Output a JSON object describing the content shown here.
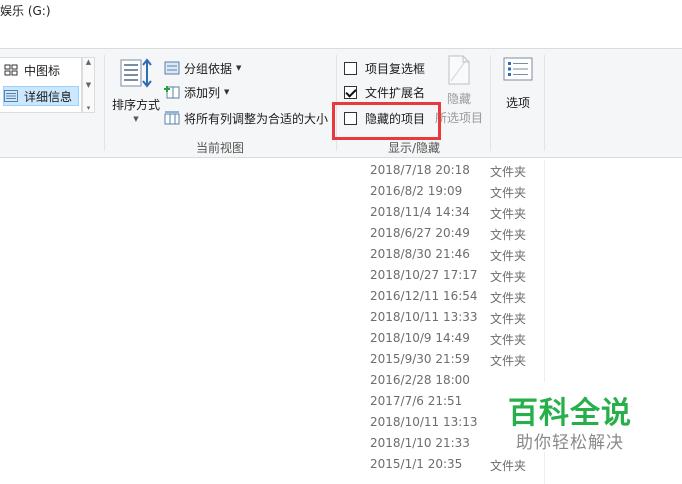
{
  "window": {
    "title": "娱乐 (G:)"
  },
  "ribbon": {
    "layout": {
      "items": [
        "中图标",
        "详细信息"
      ],
      "selected": "详细信息"
    },
    "current_view": {
      "sort_label": "排序方式",
      "group_by_label": "分组依据",
      "add_columns_label": "添加列",
      "size_columns_label": "将所有列调整为合适的大小",
      "group_name": "当前视图"
    },
    "show_hide": {
      "item_checkboxes": {
        "label": "项目复选框",
        "checked": false
      },
      "file_extensions": {
        "label": "文件扩展名",
        "checked": true
      },
      "hidden_items": {
        "label": "隐藏的项目",
        "checked": false
      },
      "hide_selected_line1": "隐藏",
      "hide_selected_line2": "所选项目",
      "group_name": "显示/隐藏"
    },
    "options_label": "选项"
  },
  "files": [
    {
      "date": "2018/7/18 20:18",
      "type": "文件夹"
    },
    {
      "date": "2016/8/2 19:09",
      "type": "文件夹"
    },
    {
      "date": "2018/11/4 14:34",
      "type": "文件夹"
    },
    {
      "date": "2018/6/27 20:49",
      "type": "文件夹"
    },
    {
      "date": "2018/8/30 21:46",
      "type": "文件夹"
    },
    {
      "date": "2018/10/27 17:17",
      "type": "文件夹"
    },
    {
      "date": "2016/12/11 16:54",
      "type": "文件夹"
    },
    {
      "date": "2018/10/11 13:33",
      "type": "文件夹"
    },
    {
      "date": "2018/10/9 14:49",
      "type": "文件夹"
    },
    {
      "date": "2015/9/30 21:59",
      "type": "文件夹"
    },
    {
      "date": "2016/2/28 18:00",
      "type": ""
    },
    {
      "date": "2017/7/6 21:51",
      "type": ""
    },
    {
      "date": "2018/10/11 13:13",
      "type": ""
    },
    {
      "date": "2018/1/10 21:33",
      "type": ""
    },
    {
      "date": "2015/1/1 20:35",
      "type": "文件夹"
    }
  ],
  "watermark": {
    "main": "百科全说",
    "sub": "助你轻松解决"
  }
}
